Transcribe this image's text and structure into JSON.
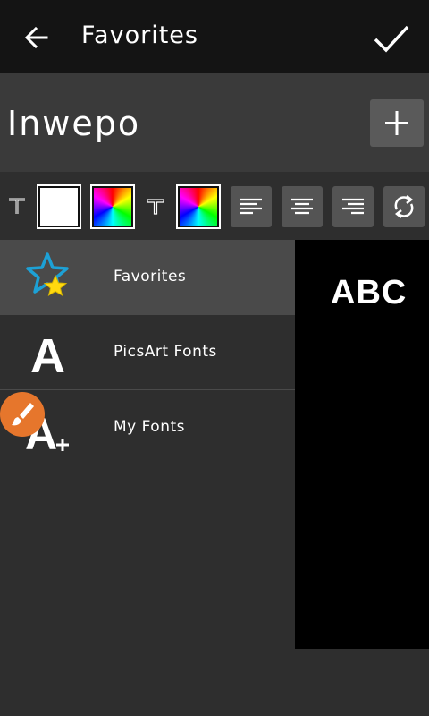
{
  "header": {
    "title": "Favorites",
    "back_icon": "arrow-left-icon",
    "confirm_icon": "check-icon"
  },
  "text_input": {
    "value": "Inwepo"
  },
  "add_button": {
    "icon": "plus-icon"
  },
  "toolbar": {
    "items": [
      {
        "name": "text-style-icon"
      },
      {
        "name": "text-color-swatch",
        "color": "#ffffff"
      },
      {
        "name": "text-gradient-swatch"
      },
      {
        "name": "outline-text-icon"
      },
      {
        "name": "outline-gradient-swatch"
      },
      {
        "name": "align-left-icon"
      },
      {
        "name": "align-center-icon"
      },
      {
        "name": "align-right-icon"
      },
      {
        "name": "refresh-icon"
      }
    ]
  },
  "font_list": {
    "items": [
      {
        "label": "Favorites",
        "icon": "star-icon",
        "selected": true
      },
      {
        "label": "PicsArt Fonts",
        "icon": "font-a-icon",
        "selected": false
      },
      {
        "label": "My Fonts",
        "icon": "font-add-icon",
        "selected": false
      }
    ]
  },
  "preview": {
    "text": "ABC"
  },
  "fab": {
    "icon": "brush-icon",
    "color": "#e6762c"
  }
}
